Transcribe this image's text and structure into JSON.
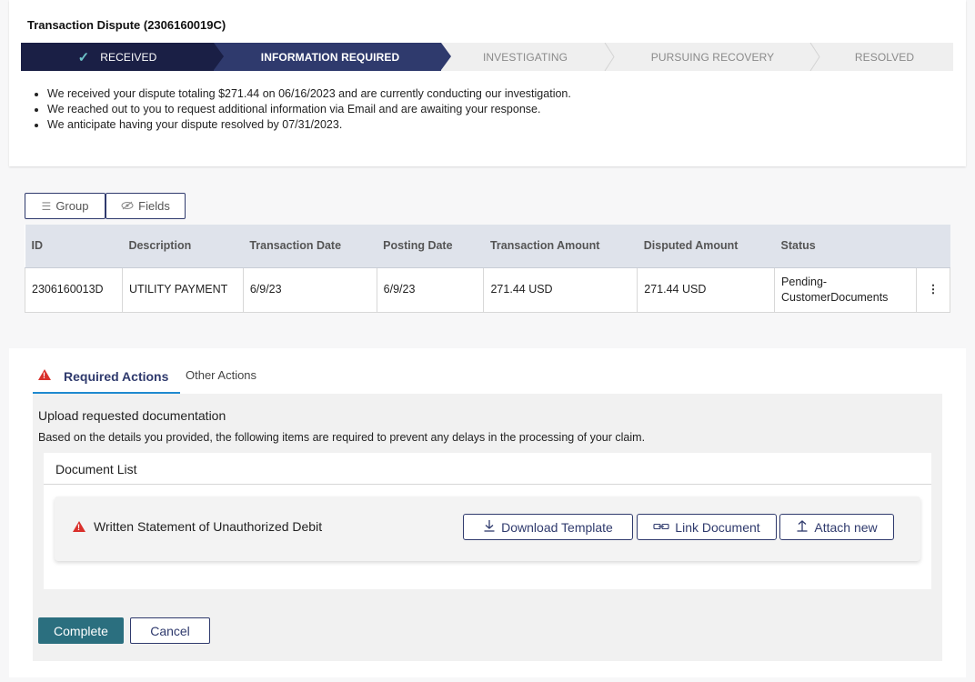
{
  "header": {
    "title": "Transaction Dispute (2306160019C)"
  },
  "stepper": {
    "steps": [
      {
        "label": "RECEIVED",
        "state": "complete"
      },
      {
        "label": "INFORMATION REQUIRED",
        "state": "current"
      },
      {
        "label": "INVESTIGATING",
        "state": "pending"
      },
      {
        "label": "PURSUING RECOVERY",
        "state": "pending"
      },
      {
        "label": "RESOLVED",
        "state": "pending"
      }
    ]
  },
  "summary": [
    "We received your dispute totaling $271.44 on 06/16/2023 and are currently conducting our investigation.",
    "We reached out to you to request additional information via Email and are awaiting your response.",
    "We anticipate having your dispute resolved by 07/31/2023."
  ],
  "table_toolbar": {
    "group_label": "Group",
    "fields_label": "Fields"
  },
  "table": {
    "headers": [
      "ID",
      "Description",
      "Transaction Date",
      "Posting Date",
      "Transaction Amount",
      "Disputed Amount",
      "Status"
    ],
    "rows": [
      [
        "2306160013D",
        "UTILITY PAYMENT",
        "6/9/23",
        "6/9/23",
        "271.44 USD",
        "271.44 USD",
        "Pending-CustomerDocuments"
      ]
    ],
    "row_menu_icon": "kebab-menu-icon"
  },
  "actions": {
    "tabs": [
      "Required Actions",
      "Other Actions"
    ],
    "active_tab": "Required Actions",
    "upload_title": "Upload requested documentation",
    "upload_description": "Based on the details you provided, the following items are required to prevent any delays in the processing of your claim.",
    "document_list_title": "Document List",
    "documents": [
      {
        "name": "Written Statement of Unauthorized Debit",
        "download_label": "Download Template",
        "link_label": "Link Document",
        "attach_label": "Attach new"
      }
    ],
    "complete_label": "Complete",
    "cancel_label": "Cancel"
  },
  "colors": {
    "step_complete": "#1a1f45",
    "step_current": "#2f3a6d",
    "accent_teal": "#2b6f7f",
    "warning_red": "#d9302b",
    "tab_underline": "#1f8ad0"
  }
}
